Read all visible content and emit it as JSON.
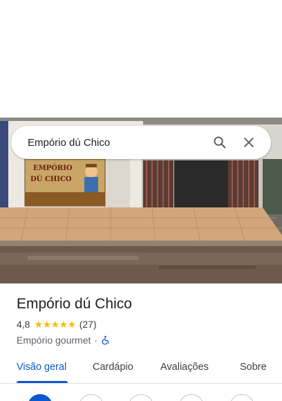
{
  "search": {
    "query": "Empório dú Chico",
    "search_icon": "search-icon",
    "close_icon": "close-icon"
  },
  "photo": {
    "sign_line1": "EMPÓRIO",
    "sign_line2": "DÚ CHICO"
  },
  "place": {
    "name": "Empório dú Chico",
    "rating": "4,8",
    "stars": "★★★★★",
    "review_count": "(27)",
    "category": "Empório gourmet",
    "separator": "·",
    "accessibility_icon": "wheelchair-icon"
  },
  "tabs": [
    {
      "label": "Visão geral",
      "active": true
    },
    {
      "label": "Cardápio",
      "active": false
    },
    {
      "label": "Avaliações",
      "active": false
    },
    {
      "label": "Sobre",
      "active": false
    }
  ],
  "actions": [
    {
      "icon": "directions-icon",
      "primary": true
    },
    {
      "icon": "start-icon",
      "primary": false
    },
    {
      "icon": "save-icon",
      "primary": false
    },
    {
      "icon": "nearby-icon",
      "primary": false
    },
    {
      "icon": "share-icon",
      "primary": false
    }
  ],
  "colors": {
    "accent": "#0b57d0",
    "star": "#fbbc04",
    "text_primary": "#202124",
    "text_secondary": "#5f6368"
  }
}
